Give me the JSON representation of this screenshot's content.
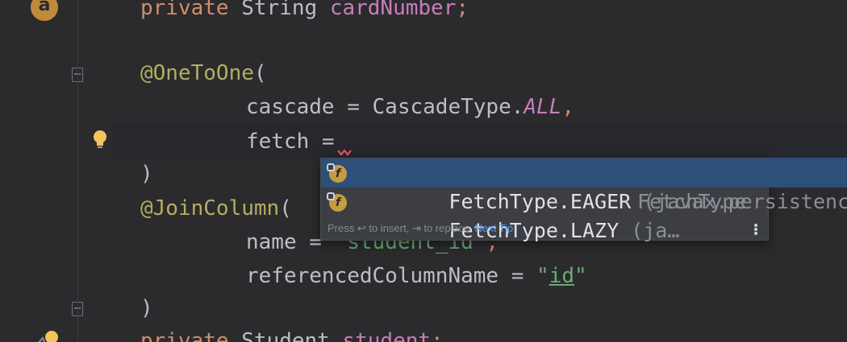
{
  "editor": {
    "lines": [
      {
        "id": "l1",
        "parts": [
          {
            "t": "private ",
            "c": "kw"
          },
          {
            "t": "String ",
            "c": "plain"
          },
          {
            "t": "cardNumber",
            "c": "field"
          },
          {
            "t": ";",
            "c": "kw"
          }
        ]
      },
      {
        "id": "l2",
        "parts": [
          {
            "t": "@OneToOne",
            "c": "anno"
          },
          {
            "t": "(",
            "c": "plain"
          }
        ]
      },
      {
        "id": "l3",
        "parts": [
          {
            "t": "cascade = CascadeType.",
            "c": "plain"
          },
          {
            "t": "ALL",
            "c": "italic-const"
          },
          {
            "t": ",",
            "c": "kw"
          }
        ]
      },
      {
        "id": "l4",
        "parts": [
          {
            "t": "fetch =",
            "c": "plain"
          }
        ]
      },
      {
        "id": "l5",
        "parts": [
          {
            "t": ")",
            "c": "plain"
          }
        ]
      },
      {
        "id": "l6",
        "parts": [
          {
            "t": "@JoinColumn",
            "c": "anno"
          },
          {
            "t": "(",
            "c": "plain"
          }
        ]
      },
      {
        "id": "l7",
        "parts": [
          {
            "t": "name = ",
            "c": "plain"
          },
          {
            "t": "\"student_id\"",
            "c": "str"
          },
          {
            "t": ",",
            "c": "kw"
          }
        ]
      },
      {
        "id": "l8",
        "parts": [
          {
            "t": "referencedColumnName = ",
            "c": "plain"
          },
          {
            "t": "\"",
            "c": "str"
          },
          {
            "t": "id",
            "c": "str ul"
          },
          {
            "t": "\"",
            "c": "str"
          }
        ]
      },
      {
        "id": "l9",
        "parts": [
          {
            "t": ")",
            "c": "plain"
          }
        ]
      },
      {
        "id": "l10",
        "parts": [
          {
            "t": "private ",
            "c": "kw"
          },
          {
            "t": "Student ",
            "c": "plain"
          },
          {
            "t": "student",
            "c": "field"
          },
          {
            "t": ";",
            "c": "kw"
          }
        ]
      }
    ]
  },
  "gutter": {
    "badge_letter": "a"
  },
  "completion": {
    "items": [
      {
        "name": "FetchType.EAGER",
        "pkg": " (javax.persistence)",
        "type": "",
        "icon": "field-icon",
        "icon_letter": "f"
      },
      {
        "name": "FetchType.LAZY",
        "pkg": " (ja…",
        "type": "FetchType",
        "icon": "field-icon",
        "icon_letter": "f"
      }
    ],
    "footer_hint": "Press ↩ to insert, ⇥ to replace",
    "next_tip": "Next Tip"
  },
  "colors": {
    "keyword": "#cf8e6d",
    "annotation": "#b3ae60",
    "field": "#c77dbb",
    "string": "#6aab73",
    "selection": "#2e4f78"
  }
}
